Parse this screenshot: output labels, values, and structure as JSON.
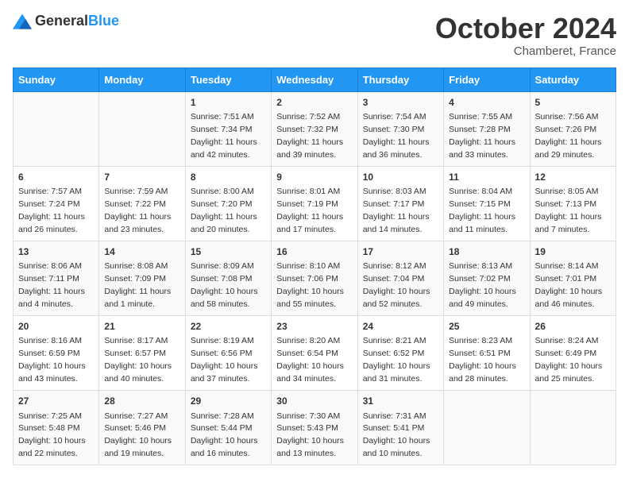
{
  "header": {
    "logo_general": "General",
    "logo_blue": "Blue",
    "month": "October 2024",
    "location": "Chamberet, France"
  },
  "weekdays": [
    "Sunday",
    "Monday",
    "Tuesday",
    "Wednesday",
    "Thursday",
    "Friday",
    "Saturday"
  ],
  "weeks": [
    [
      {
        "day": "",
        "content": ""
      },
      {
        "day": "",
        "content": ""
      },
      {
        "day": "1",
        "content": "Sunrise: 7:51 AM\nSunset: 7:34 PM\nDaylight: 11 hours and 42 minutes."
      },
      {
        "day": "2",
        "content": "Sunrise: 7:52 AM\nSunset: 7:32 PM\nDaylight: 11 hours and 39 minutes."
      },
      {
        "day": "3",
        "content": "Sunrise: 7:54 AM\nSunset: 7:30 PM\nDaylight: 11 hours and 36 minutes."
      },
      {
        "day": "4",
        "content": "Sunrise: 7:55 AM\nSunset: 7:28 PM\nDaylight: 11 hours and 33 minutes."
      },
      {
        "day": "5",
        "content": "Sunrise: 7:56 AM\nSunset: 7:26 PM\nDaylight: 11 hours and 29 minutes."
      }
    ],
    [
      {
        "day": "6",
        "content": "Sunrise: 7:57 AM\nSunset: 7:24 PM\nDaylight: 11 hours and 26 minutes."
      },
      {
        "day": "7",
        "content": "Sunrise: 7:59 AM\nSunset: 7:22 PM\nDaylight: 11 hours and 23 minutes."
      },
      {
        "day": "8",
        "content": "Sunrise: 8:00 AM\nSunset: 7:20 PM\nDaylight: 11 hours and 20 minutes."
      },
      {
        "day": "9",
        "content": "Sunrise: 8:01 AM\nSunset: 7:19 PM\nDaylight: 11 hours and 17 minutes."
      },
      {
        "day": "10",
        "content": "Sunrise: 8:03 AM\nSunset: 7:17 PM\nDaylight: 11 hours and 14 minutes."
      },
      {
        "day": "11",
        "content": "Sunrise: 8:04 AM\nSunset: 7:15 PM\nDaylight: 11 hours and 11 minutes."
      },
      {
        "day": "12",
        "content": "Sunrise: 8:05 AM\nSunset: 7:13 PM\nDaylight: 11 hours and 7 minutes."
      }
    ],
    [
      {
        "day": "13",
        "content": "Sunrise: 8:06 AM\nSunset: 7:11 PM\nDaylight: 11 hours and 4 minutes."
      },
      {
        "day": "14",
        "content": "Sunrise: 8:08 AM\nSunset: 7:09 PM\nDaylight: 11 hours and 1 minute."
      },
      {
        "day": "15",
        "content": "Sunrise: 8:09 AM\nSunset: 7:08 PM\nDaylight: 10 hours and 58 minutes."
      },
      {
        "day": "16",
        "content": "Sunrise: 8:10 AM\nSunset: 7:06 PM\nDaylight: 10 hours and 55 minutes."
      },
      {
        "day": "17",
        "content": "Sunrise: 8:12 AM\nSunset: 7:04 PM\nDaylight: 10 hours and 52 minutes."
      },
      {
        "day": "18",
        "content": "Sunrise: 8:13 AM\nSunset: 7:02 PM\nDaylight: 10 hours and 49 minutes."
      },
      {
        "day": "19",
        "content": "Sunrise: 8:14 AM\nSunset: 7:01 PM\nDaylight: 10 hours and 46 minutes."
      }
    ],
    [
      {
        "day": "20",
        "content": "Sunrise: 8:16 AM\nSunset: 6:59 PM\nDaylight: 10 hours and 43 minutes."
      },
      {
        "day": "21",
        "content": "Sunrise: 8:17 AM\nSunset: 6:57 PM\nDaylight: 10 hours and 40 minutes."
      },
      {
        "day": "22",
        "content": "Sunrise: 8:19 AM\nSunset: 6:56 PM\nDaylight: 10 hours and 37 minutes."
      },
      {
        "day": "23",
        "content": "Sunrise: 8:20 AM\nSunset: 6:54 PM\nDaylight: 10 hours and 34 minutes."
      },
      {
        "day": "24",
        "content": "Sunrise: 8:21 AM\nSunset: 6:52 PM\nDaylight: 10 hours and 31 minutes."
      },
      {
        "day": "25",
        "content": "Sunrise: 8:23 AM\nSunset: 6:51 PM\nDaylight: 10 hours and 28 minutes."
      },
      {
        "day": "26",
        "content": "Sunrise: 8:24 AM\nSunset: 6:49 PM\nDaylight: 10 hours and 25 minutes."
      }
    ],
    [
      {
        "day": "27",
        "content": "Sunrise: 7:25 AM\nSunset: 5:48 PM\nDaylight: 10 hours and 22 minutes."
      },
      {
        "day": "28",
        "content": "Sunrise: 7:27 AM\nSunset: 5:46 PM\nDaylight: 10 hours and 19 minutes."
      },
      {
        "day": "29",
        "content": "Sunrise: 7:28 AM\nSunset: 5:44 PM\nDaylight: 10 hours and 16 minutes."
      },
      {
        "day": "30",
        "content": "Sunrise: 7:30 AM\nSunset: 5:43 PM\nDaylight: 10 hours and 13 minutes."
      },
      {
        "day": "31",
        "content": "Sunrise: 7:31 AM\nSunset: 5:41 PM\nDaylight: 10 hours and 10 minutes."
      },
      {
        "day": "",
        "content": ""
      },
      {
        "day": "",
        "content": ""
      }
    ]
  ]
}
